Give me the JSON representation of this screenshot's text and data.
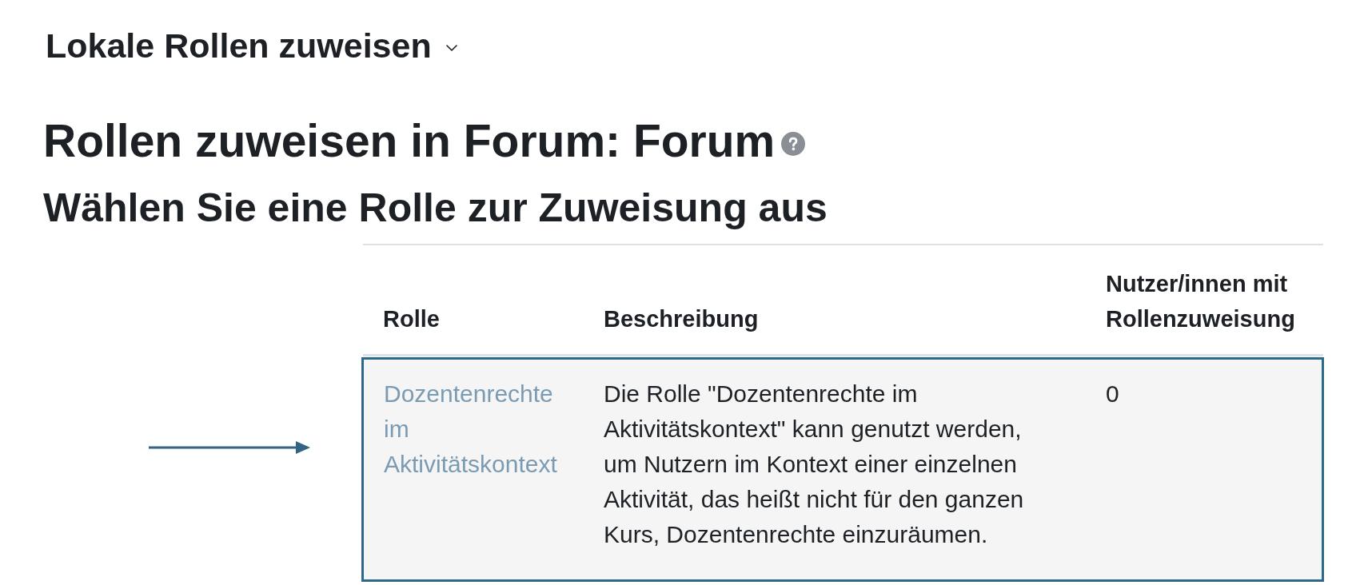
{
  "page_select": {
    "label": "Lokale Rollen zuweisen"
  },
  "heading": {
    "title": "Rollen zuweisen in Forum: Forum"
  },
  "subheading": "Wählen Sie eine Rolle zur Zuweisung aus",
  "table": {
    "columns": [
      "Rolle",
      "Beschreibung",
      "Nutzer/innen mit Rollenzuweisung"
    ],
    "rows": [
      {
        "role": "Dozentenrechte im Aktivitätskontext",
        "description": "Die Rolle \"Dozentenrechte im Aktivitätskontext\" kann genutzt werden, um Nutzern im Kontext einer einzelnen Aktivität, das heißt nicht für den ganzen Kurs, Dozentenrechte einzuräumen.",
        "count": "0",
        "highlighted": true
      }
    ]
  }
}
